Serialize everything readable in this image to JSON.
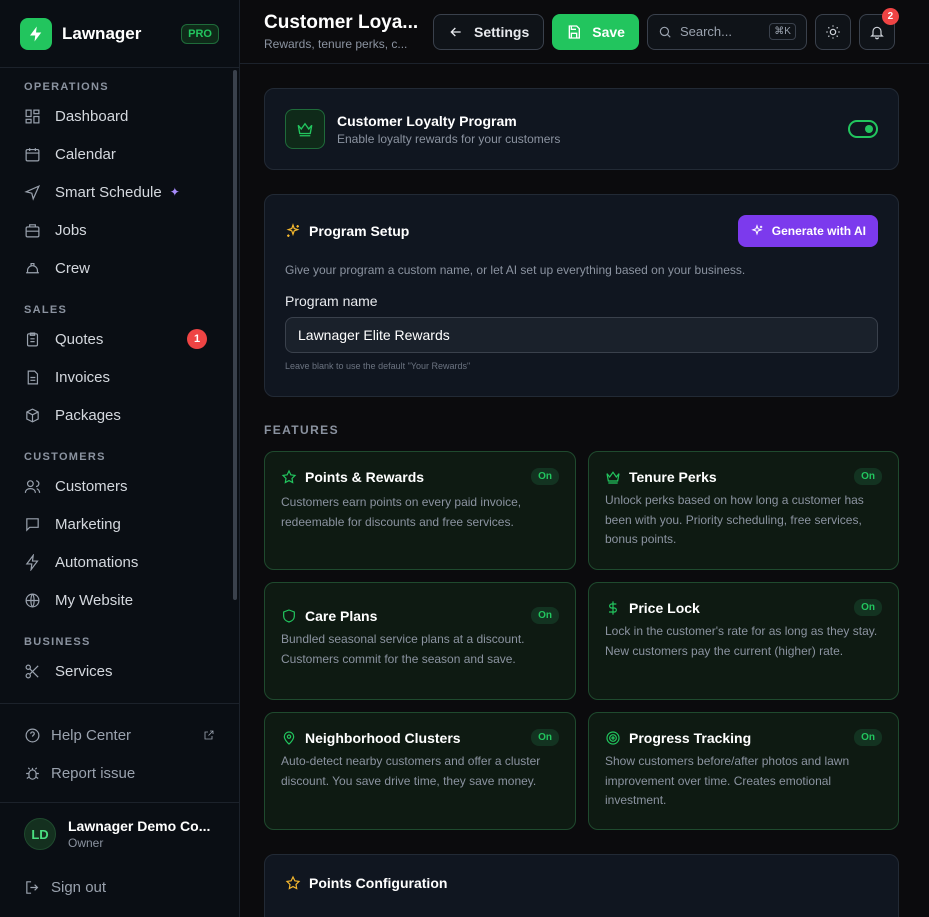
{
  "brand": {
    "name": "Lawnager",
    "badge": "PRO"
  },
  "sidebar": {
    "sections": [
      {
        "title": "OPERATIONS",
        "items": [
          {
            "label": "Dashboard",
            "icon": "dashboard-icon"
          },
          {
            "label": "Calendar",
            "icon": "calendar-icon"
          },
          {
            "label": "Smart Schedule",
            "icon": "navigation-icon",
            "sparkle": "✦"
          },
          {
            "label": "Jobs",
            "icon": "briefcase-icon"
          },
          {
            "label": "Crew",
            "icon": "hardhat-icon"
          }
        ]
      },
      {
        "title": "SALES",
        "items": [
          {
            "label": "Quotes",
            "icon": "clipboard-icon",
            "badge": "1"
          },
          {
            "label": "Invoices",
            "icon": "file-icon"
          },
          {
            "label": "Packages",
            "icon": "package-icon"
          }
        ]
      },
      {
        "title": "CUSTOMERS",
        "items": [
          {
            "label": "Customers",
            "icon": "users-icon"
          },
          {
            "label": "Marketing",
            "icon": "message-icon"
          },
          {
            "label": "Automations",
            "icon": "zap-icon"
          },
          {
            "label": "My Website",
            "icon": "globe-icon"
          }
        ]
      },
      {
        "title": "BUSINESS",
        "items": [
          {
            "label": "Services",
            "icon": "scissors-icon"
          }
        ]
      }
    ],
    "footer": {
      "help": "Help Center",
      "report": "Report issue"
    },
    "user": {
      "initials": "LD",
      "name": "Lawnager Demo Co...",
      "role": "Owner"
    },
    "signout": "Sign out"
  },
  "header": {
    "title": "Customer Loya...",
    "subtitle": "Rewards, tenure perks, c...",
    "settings_label": "Settings",
    "save_label": "Save",
    "search_placeholder": "Search...",
    "shortcut": "⌘K",
    "notifications": "2"
  },
  "loyalty": {
    "title": "Customer Loyalty Program",
    "subtitle": "Enable loyalty rewards for your customers",
    "enabled": true
  },
  "setup": {
    "title": "Program Setup",
    "ai_button": "Generate with AI",
    "description": "Give your program a custom name, or let AI set up everything based on your business.",
    "field_label": "Program name",
    "field_value": "Lawnager Elite Rewards",
    "hint": "Leave blank to use the default \"Your Rewards\""
  },
  "features": {
    "label": "FEATURES",
    "items": [
      {
        "title": "Points & Rewards",
        "status": "On",
        "icon": "star-icon",
        "desc": "Customers earn points on every paid invoice, redeemable for discounts and free services."
      },
      {
        "title": "Tenure Perks",
        "status": "On",
        "icon": "crown-icon",
        "desc": "Unlock perks based on how long a customer has been with you. Priority scheduling, free services, bonus points."
      },
      {
        "title": "Care Plans",
        "status": "On",
        "icon": "shield-icon",
        "desc": "Bundled seasonal service plans at a discount. Customers commit for the season and save."
      },
      {
        "title": "Price Lock",
        "status": "On",
        "icon": "dollar-icon",
        "desc": "Lock in the customer's rate for as long as they stay. New customers pay the current (higher) rate."
      },
      {
        "title": "Neighborhood Clusters",
        "status": "On",
        "icon": "map-pin-icon",
        "desc": "Auto-detect nearby customers and offer a cluster discount. You save drive time, they save money."
      },
      {
        "title": "Progress Tracking",
        "status": "On",
        "icon": "target-icon",
        "desc": "Show customers before/after photos and lawn improvement over time. Creates emotional investment."
      }
    ]
  },
  "points_config": {
    "title": "Points Configuration"
  }
}
